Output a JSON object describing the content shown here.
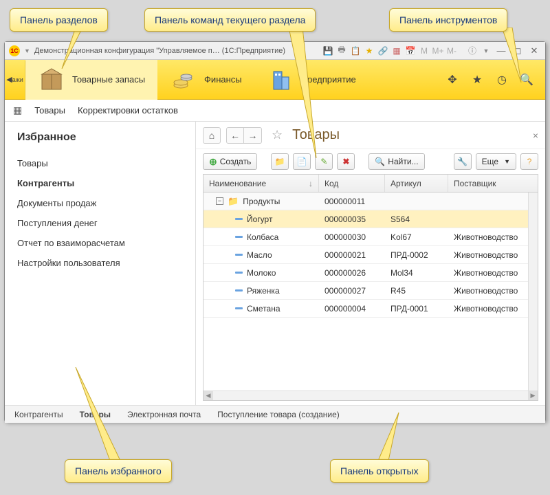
{
  "callouts": {
    "sections": "Панель разделов",
    "commands": "Панель команд текущего раздела",
    "tools": "Панель инструментов",
    "favorites": "Панель избранного",
    "open": "Панель открытых"
  },
  "titlebar": {
    "title": "Демонстрационная конфигурация \"Управляемое п…    (1С:Предприятие)"
  },
  "sections": {
    "nav_back_hint": "ажи",
    "items": [
      {
        "label": "Товарные запасы"
      },
      {
        "label": "Финансы"
      },
      {
        "label": "Предприятие"
      }
    ]
  },
  "commands": {
    "items": [
      "Товары",
      "Корректировки остатков"
    ]
  },
  "favorites": {
    "title": "Избранное",
    "items": [
      {
        "label": "Товары",
        "bold": false
      },
      {
        "label": "Контрагенты",
        "bold": true
      },
      {
        "label": "Документы продаж",
        "bold": false
      },
      {
        "label": "Поступления денег",
        "bold": false
      },
      {
        "label": "Отчет по взаиморасчетам",
        "bold": false
      },
      {
        "label": "Настройки пользователя",
        "bold": false
      }
    ]
  },
  "page": {
    "title": "Товары"
  },
  "toolbar": {
    "create": "Создать",
    "find": "Найти...",
    "more": "Еще"
  },
  "grid": {
    "columns": [
      "Наименование",
      "Код",
      "Артикул",
      "Поставщик"
    ],
    "sort_arrow": "↓",
    "rows": [
      {
        "type": "folder",
        "name": "Продукты",
        "code": "000000011",
        "article": "",
        "supplier": ""
      },
      {
        "type": "item",
        "selected": true,
        "name": "Йогурт",
        "code": "000000035",
        "article": "S564",
        "supplier": ""
      },
      {
        "type": "item",
        "name": "Колбаса",
        "code": "000000030",
        "article": "Kol67",
        "supplier": "Животноводство"
      },
      {
        "type": "item",
        "name": "Масло",
        "code": "000000021",
        "article": "ПРД-0002",
        "supplier": "Животноводство"
      },
      {
        "type": "item",
        "name": "Молоко",
        "code": "000000026",
        "article": "Mol34",
        "supplier": "Животноводство"
      },
      {
        "type": "item",
        "name": "Ряженка",
        "code": "000000027",
        "article": "R45",
        "supplier": "Животноводство"
      },
      {
        "type": "item",
        "name": "Сметана",
        "code": "000000004",
        "article": "ПРД-0001",
        "supplier": "Животноводство"
      }
    ]
  },
  "open_panel": {
    "items": [
      {
        "label": "Контрагенты",
        "bold": false
      },
      {
        "label": "Товары",
        "bold": true
      },
      {
        "label": "Электронная почта",
        "bold": false
      },
      {
        "label": "Поступление товара (создание)",
        "bold": false
      }
    ]
  }
}
